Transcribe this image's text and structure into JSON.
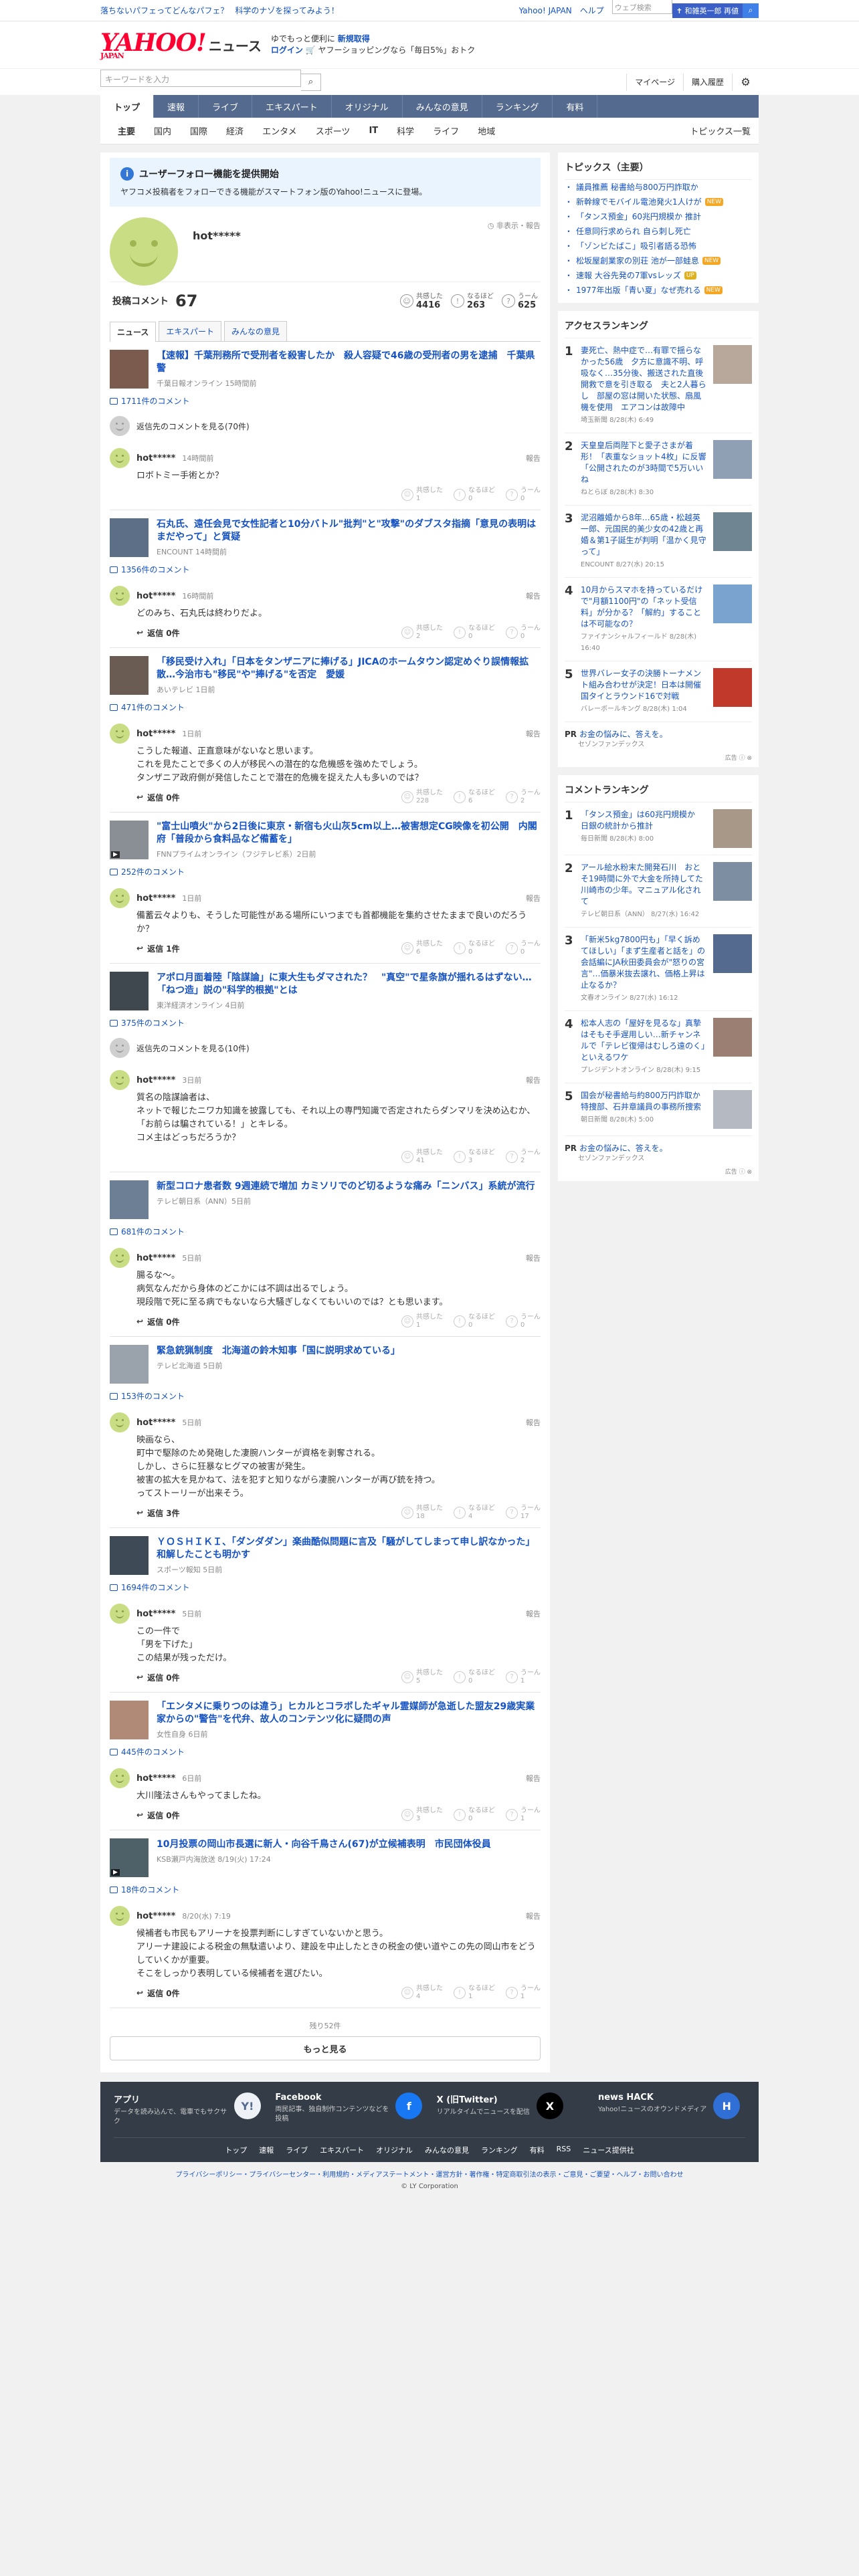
{
  "topbar": {
    "links": [
      "落ちないパフェってどんなパフェ？",
      "科学のナゾを探ってみよう！"
    ],
    "right": [
      "Yahoo! JAPAN",
      "ヘルプ"
    ],
    "search_placeholder": "ウェブ検索",
    "search_btn": "✝ 和雑英一郎 再値"
  },
  "header": {
    "logo": "YAHOO!",
    "logo_sub": "JAPAN",
    "news": "ニュース",
    "promo1": "ゆでもっと便利に",
    "promo1_link": "新規取得",
    "promo2_link": "ログイン",
    "promo2": "ヤフーショッピングなら「毎日5%」おトク"
  },
  "search": {
    "placeholder": "キーワードを入力",
    "mypage": "マイページ",
    "history": "購入履歴"
  },
  "nav": [
    "トップ",
    "速報",
    "ライブ",
    "エキスパート",
    "オリジナル",
    "みんなの意見",
    "ランキング",
    "有料"
  ],
  "subnav": [
    "主要",
    "国内",
    "国際",
    "経済",
    "エンタメ",
    "スポーツ",
    "IT",
    "科学",
    "ライフ",
    "地域"
  ],
  "subnav_all": "トピックス一覧",
  "notice": {
    "title": "ユーザーフォロー機能を提供開始",
    "desc": "ヤフコメ投稿者をフォローできる機能がスマートフォン版のYahoo!ニュースに登場。"
  },
  "profile": {
    "name": "hot*****",
    "report": "非表示・報告"
  },
  "stats": {
    "label": "投稿コメント",
    "count": "67",
    "s1_label": "共感した",
    "s1": "4416",
    "s2_label": "なるほど",
    "s2": "263",
    "s3_label": "うーん",
    "s3": "625"
  },
  "tabs": [
    "ニュース",
    "エキスパート",
    "みんなの意見"
  ],
  "labels": {
    "reply": "返信",
    "report": "報告",
    "agree": "共感した",
    "nice": "なるほど",
    "hmm": "うーん"
  },
  "cards": [
    {
      "title": "【速報】千葉刑務所で受刑者を殺害したか　殺人容疑で46歳の受刑者の男を逮捕　千葉県警",
      "src": "千葉日報オンライン 15時間前",
      "comments": "1711件のコメント",
      "parent": "返信先のコメントを見る(70件)",
      "time": "14時間前",
      "body": "ロボトミー手術とか？",
      "reply": "",
      "r": [
        "1",
        "0",
        "0"
      ]
    },
    {
      "title": "石丸氏、遠任会見で女性記者と10分バトル\"批判\"と\"攻撃\"のダブスタ指摘「意見の表明はまだやって」と質疑",
      "src": "ENCOUNT 14時間前",
      "comments": "1356件のコメント",
      "parent": "",
      "time": "16時間前",
      "body": "どのみち、石丸氏は終わりだよ。",
      "reply": "返信 0件",
      "r": [
        "2",
        "0",
        "0"
      ]
    },
    {
      "title": "「移民受け入れ」「日本をタンザニアに捧げる」JICAのホームタウン認定めぐり誤情報拡散…今治市も\"移民\"や\"捧げる\"を否定　愛媛",
      "src": "あいテレビ 1日前",
      "comments": "471件のコメント",
      "parent": "",
      "time": "1日前",
      "body": "こうした報道、正直意味がないなと思います。\nこれを見たことで多くの人が移民への潜在的な危機感を強めたでしょう。\nタンザニア政府側が発信したことで潜在的危機を捉えた人も多いのでは？",
      "reply": "返信 0件",
      "r": [
        "228",
        "6",
        "2"
      ]
    },
    {
      "title": "\"富士山噴火\"から2日後に東京・新宿も火山灰5cm以上…被害想定CG映像を初公開　内閣府「普段から食料品など備蓄を」",
      "src": "FNNプライムオンライン（フジテレビ系）2日前",
      "comments": "252件のコメント",
      "parent": "",
      "time": "1日前",
      "body": "備蓄云々よりも、そうした可能性がある場所にいつまでも首都機能を集約させたままで良いのだろうか？",
      "reply": "返信 1件",
      "r": [
        "6",
        "0",
        "0"
      ]
    },
    {
      "title": "アポロ月面着陸「陰謀論」に東大生もダマされた？　\"真空\"で星条旗が揺れるはずない…「ねつ造」説の\"科学的根拠\"とは",
      "src": "東洋経済オンライン 4日前",
      "comments": "375件のコメント",
      "parent": "返信先のコメントを見る(10件)",
      "time": "3日前",
      "body": "質名の陰謀論者は、\nネットで報じたニワカ知識を披露しても、それ以上の専門知識で否定されたらダンマリを決め込むか、「お前らは騙されている！」とキレる。\nコメ主はどっちだろうか？",
      "reply": "",
      "r": [
        "41",
        "3",
        "2"
      ]
    },
    {
      "title": "新型コロナ患者数 9週連続で増加 カミソリでのど切るような痛み「ニンバス」系統が流行",
      "src": "テレビ朝日系（ANN）5日前",
      "comments": "681件のコメント",
      "parent": "",
      "time": "5日前",
      "body": "腸るな〜。\n病気なんだから身体のどこかには不調は出るでしょう。\n現段階で死に至る病でもないなら大騒ぎしなくてもいいのでは？とも思います。",
      "reply": "返信 0件",
      "r": [
        "1",
        "0",
        "0"
      ]
    },
    {
      "title": "緊急銃猟制度　北海道の鈴木知事「国に説明求めている」",
      "src": "テレビ北海道 5日前",
      "comments": "153件のコメント",
      "parent": "",
      "time": "5日前",
      "body": "映画なら、\n町中で駆除のため発砲した凄腕ハンターが資格を剥奪される。\nしかし、さらに狂暴なヒグマの被害が発生。\n被害の拡大を見かねて、法を犯すと知りながら凄腕ハンターが再び銃を持つ。\nってストーリーが出来そう。",
      "reply": "返信 3件",
      "r": [
        "18",
        "4",
        "17"
      ]
    },
    {
      "title": "ＹＯＳＨＩＫＩ、「ダンダダン」楽曲酷似問題に言及「騒がしてしまって申し訳なかった」和解したことも明かす",
      "src": "スポーツ報知 5日前",
      "comments": "1694件のコメント",
      "parent": "",
      "time": "5日前",
      "body": "この一件で\n「男を下げた」\nこの結果が残っただけ。",
      "reply": "返信 0件",
      "r": [
        "5",
        "0",
        "1"
      ]
    },
    {
      "title": "「エンタメに乗りつのは違う」ヒカルとコラボしたギャル霊媒師が急逝した盟友29歳実業家からの\"警告\"を代弁、故人のコンテンツ化に疑問の声",
      "src": "女性自身 6日前",
      "comments": "445件のコメント",
      "parent": "",
      "time": "6日前",
      "body": "大川隆法さんもやってましたね。",
      "reply": "返信 0件",
      "r": [
        "3",
        "0",
        "1"
      ]
    },
    {
      "title": "10月投票の岡山市長選に新人・向谷千鳥さん(67)が立候補表明　市民団体役員",
      "src": "KSB瀬戸内海放送 8/19(火) 17:24",
      "comments": "18件のコメント",
      "parent": "",
      "time": "8/20(水) 7:19",
      "body": "候補者も市民もアリーナを投票判断にしすぎていないかと思う。\nアリーナ建設による税金の無駄遣いより、建設を中止したときの税金の使い道やこの先の岡山市をどうしていくかが重要。\nそこをしっかり表明している候補者を選びたい。",
      "reply": "返信 0件",
      "r": [
        "4",
        "1",
        "1"
      ]
    }
  ],
  "more": {
    "info": "残り52件",
    "btn": "もっと見る"
  },
  "topics": {
    "title": "トピックス（主要）",
    "items": [
      {
        "t": "議員推薦 秘書給与800万円詐取か",
        "b": ""
      },
      {
        "t": "新幹線でモバイル電池発火1人けが",
        "b": "new"
      },
      {
        "t": "「タンス預金」60兆円規模か 推計",
        "b": ""
      },
      {
        "t": "任意同行求められ 自ら刺し死亡",
        "b": ""
      },
      {
        "t": "「ゾンビたばこ」吸引者語る恐怖",
        "b": ""
      },
      {
        "t": "松坂屋創業家の別荘 池が一部蛙息",
        "b": "new"
      },
      {
        "t": "速報 大谷先発の7軍vsレッズ",
        "b": "up"
      },
      {
        "t": "1977年出版「青い夏」なぜ売れる",
        "b": "new"
      }
    ]
  },
  "access": {
    "title": "アクセスランキング",
    "items": [
      {
        "n": "1",
        "t": "妻死亡、熱中症で…有罪で揺らなかった56歳　夕方に意識不明、呼吸なく…35分後、搬送された直後開救で意を引き取る　夫と2人暮らし　部屋の窓は開いた状態、扇風機を使用　エアコンは故障中",
        "s": "埼玉新聞 8/28(木) 6:49"
      },
      {
        "n": "2",
        "t": "天皇皇后両陛下と愛子さまが着形！「表重なショット4枚」に反響「公開されたのが3時間で5万いいね",
        "s": "ねとらぼ 8/28(木) 8:30"
      },
      {
        "n": "3",
        "t": "泥沼離婚から8年…65歳・松越英一郎、元国民的美少女の42歳と再婚＆第1子誕生が判明「温かく見守って」",
        "s": "ENCOUNT 8/27(水) 20:15"
      },
      {
        "n": "4",
        "t": "10月からスマホを持っているだけで\"月額1100円\"の「ネット受信料」が分かる？「解約」することは不可能なの？",
        "s": "ファイナンシャルフィールド 8/28(木) 16:40"
      },
      {
        "n": "5",
        "t": "世界バレー女子の決勝トーナメント組み合わせが決定！日本は開催国タイとラウンド16で対戦",
        "s": "バレーボールキング 8/28(木) 1:04"
      }
    ]
  },
  "pr1": {
    "b": "PR",
    "t": "お金の悩みに、答えを。",
    "s": "セゾンファンデックス"
  },
  "adlabel": "広告",
  "comrank": {
    "title": "コメントランキング",
    "items": [
      {
        "n": "1",
        "t": "「タンス預金」は60兆円規模か　日銀の統計から推計",
        "s": "毎日新聞 8/28(木) 8:00"
      },
      {
        "n": "2",
        "t": "アール絵水粉末た開発石川　おとそ19時間に外で大金を所持してた川崎市の少年。マニュアル化されて",
        "s": "テレビ朝日系（ANN） 8/27(水) 16:42"
      },
      {
        "n": "3",
        "t": "「新米5kg7800円も」「早く訴めてほしい」「まず生産者と話を」の会話編にJA秋田委員会が\"怒りの宮言\"…価暴米抜去譲れ、価格上昇は止なるか？",
        "s": "文春オンライン 8/27(水) 16:12"
      },
      {
        "n": "4",
        "t": "松本人志の「屋好を見るな」真摯はそもそ手遅用しい…新チャンネルで「テレビ復帰はむしろ遠のく」といえるワケ",
        "s": "プレジデントオンライン 8/28(木) 9:15"
      },
      {
        "n": "5",
        "t": "国会が秘書給与約800万円詐取か　特捜部、石井章議員の事務所捜索",
        "s": "朝日新聞 8/28(木) 5:00"
      }
    ]
  },
  "pr2": {
    "b": "PR",
    "t": "お金の悩みに、答えを。",
    "s": "セゾンファンデックス"
  },
  "footer": {
    "apps": [
      {
        "t": "アプリ",
        "d": "データを読み込んで、電車でもサクサク",
        "i": "Y!"
      },
      {
        "t": "Facebook",
        "d": "両民記事、独自制作コンテンツなどを投稿",
        "i": "f"
      },
      {
        "t": "X (旧Twitter)",
        "d": "リアルタイムでニュースを配信",
        "i": "X"
      },
      {
        "t": "news HACK",
        "d": "Yahoo!ニュースのオウンドメディア",
        "i": "H"
      }
    ],
    "links": [
      "トップ",
      "速報",
      "ライブ",
      "エキスパート",
      "オリジナル",
      "みんなの意見",
      "ランキング",
      "有料",
      "RSS",
      "ニュース提供社"
    ],
    "legal": "プライバシーポリシー・プライバシーセンター・利用規約・メディアステートメント・運営方針・著作権・特定商取引法の表示・ご意見・ご要望・ヘルプ・お問い合わせ",
    "copy": "© LY Corporation"
  },
  "colors": {
    "accent": "#1552c2",
    "nav": "#546a8e",
    "logo": "#ff0033",
    "avatar": "#c9de84"
  }
}
